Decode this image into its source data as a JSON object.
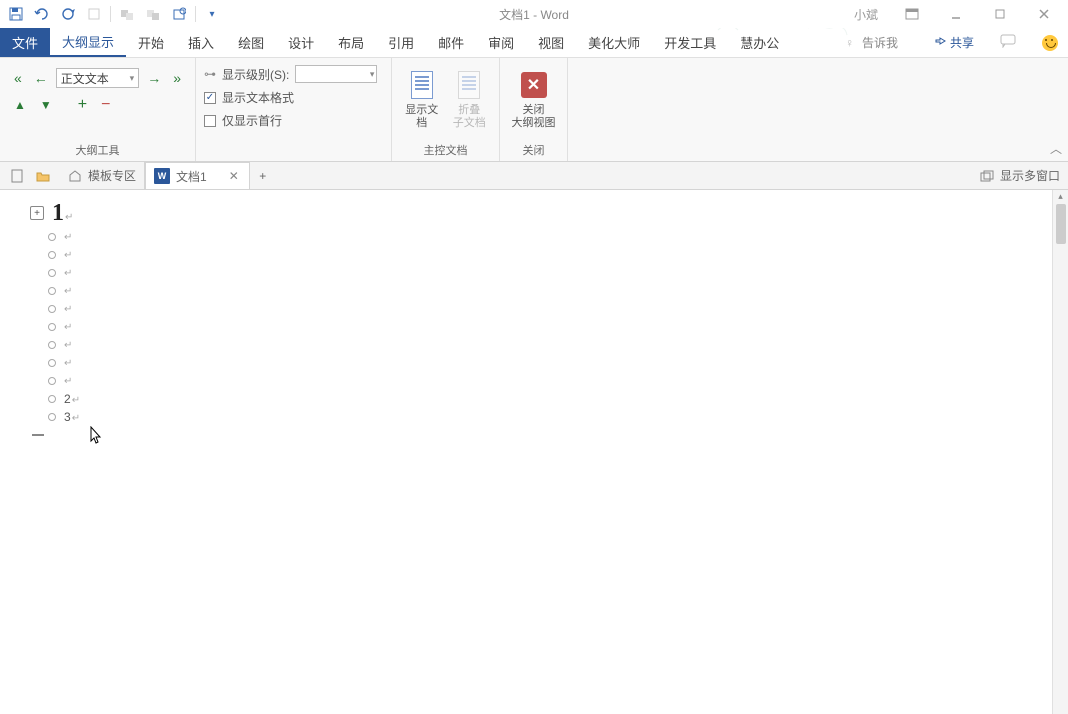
{
  "title": "文档1  -  Word",
  "username": "小斌",
  "tabs": {
    "file": "文件",
    "outline": "大纲显示",
    "home": "开始",
    "insert": "插入",
    "draw": "绘图",
    "design": "设计",
    "layout": "布局",
    "references": "引用",
    "mail": "邮件",
    "review": "审阅",
    "view": "视图",
    "beautify": "美化大师",
    "developer": "开发工具",
    "hui": "慧办公",
    "tell_me": "告诉我",
    "share": "共享"
  },
  "ribbon": {
    "outline_level_value": "正文文本",
    "show_level_label": "显示级别(S):",
    "show_text_format": "显示文本格式",
    "show_first_line": "仅显示首行",
    "group_outline_tools": "大纲工具",
    "show_doc": "显示文档",
    "collapse_sub": "折叠\n子文档",
    "group_master": "主控文档",
    "close_outline": "关闭\n大纲视图",
    "close_label": "关闭",
    "group_close": "关闭"
  },
  "doctabs": {
    "template_zone": "模板专区",
    "doc1": "文档1",
    "show_multi": "显示多窗口"
  },
  "outline": {
    "heading": "1",
    "line2": "2",
    "line3": "3"
  }
}
